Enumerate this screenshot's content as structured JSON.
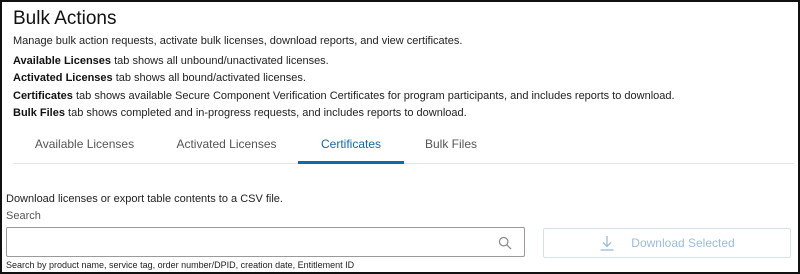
{
  "page": {
    "title": "Bulk Actions",
    "description": "Manage bulk action requests, activate bulk licenses, download reports, and view certificates."
  },
  "tab_descriptions": [
    {
      "name": "Available Licenses",
      "text": " tab shows all unbound/unactivated licenses."
    },
    {
      "name": "Activated Licenses",
      "text": " tab shows all bound/activated licenses."
    },
    {
      "name": "Certificates",
      "text": " tab shows available Secure Component Verification Certificates for program participants, and includes reports to download."
    },
    {
      "name": "Bulk Files",
      "text": " tab shows completed and in-progress requests, and includes reports to download."
    }
  ],
  "tabs": [
    {
      "label": "Available Licenses",
      "active": false
    },
    {
      "label": "Activated Licenses",
      "active": false
    },
    {
      "label": "Certificates",
      "active": true
    },
    {
      "label": "Bulk Files",
      "active": false
    }
  ],
  "download_info": "Download licenses or export table contents to a CSV file.",
  "search": {
    "label": "Search",
    "value": "",
    "placeholder": "",
    "helper": "Search by product name, service tag, order number/DPID, creation date, Entitlement ID",
    "icon": "search-icon"
  },
  "download_button": {
    "label": "Download Selected",
    "icon": "download-icon",
    "enabled": false
  },
  "colors": {
    "accent": "#0e6aa8",
    "disabled_text": "#9cbcd9",
    "border": "#111111"
  }
}
